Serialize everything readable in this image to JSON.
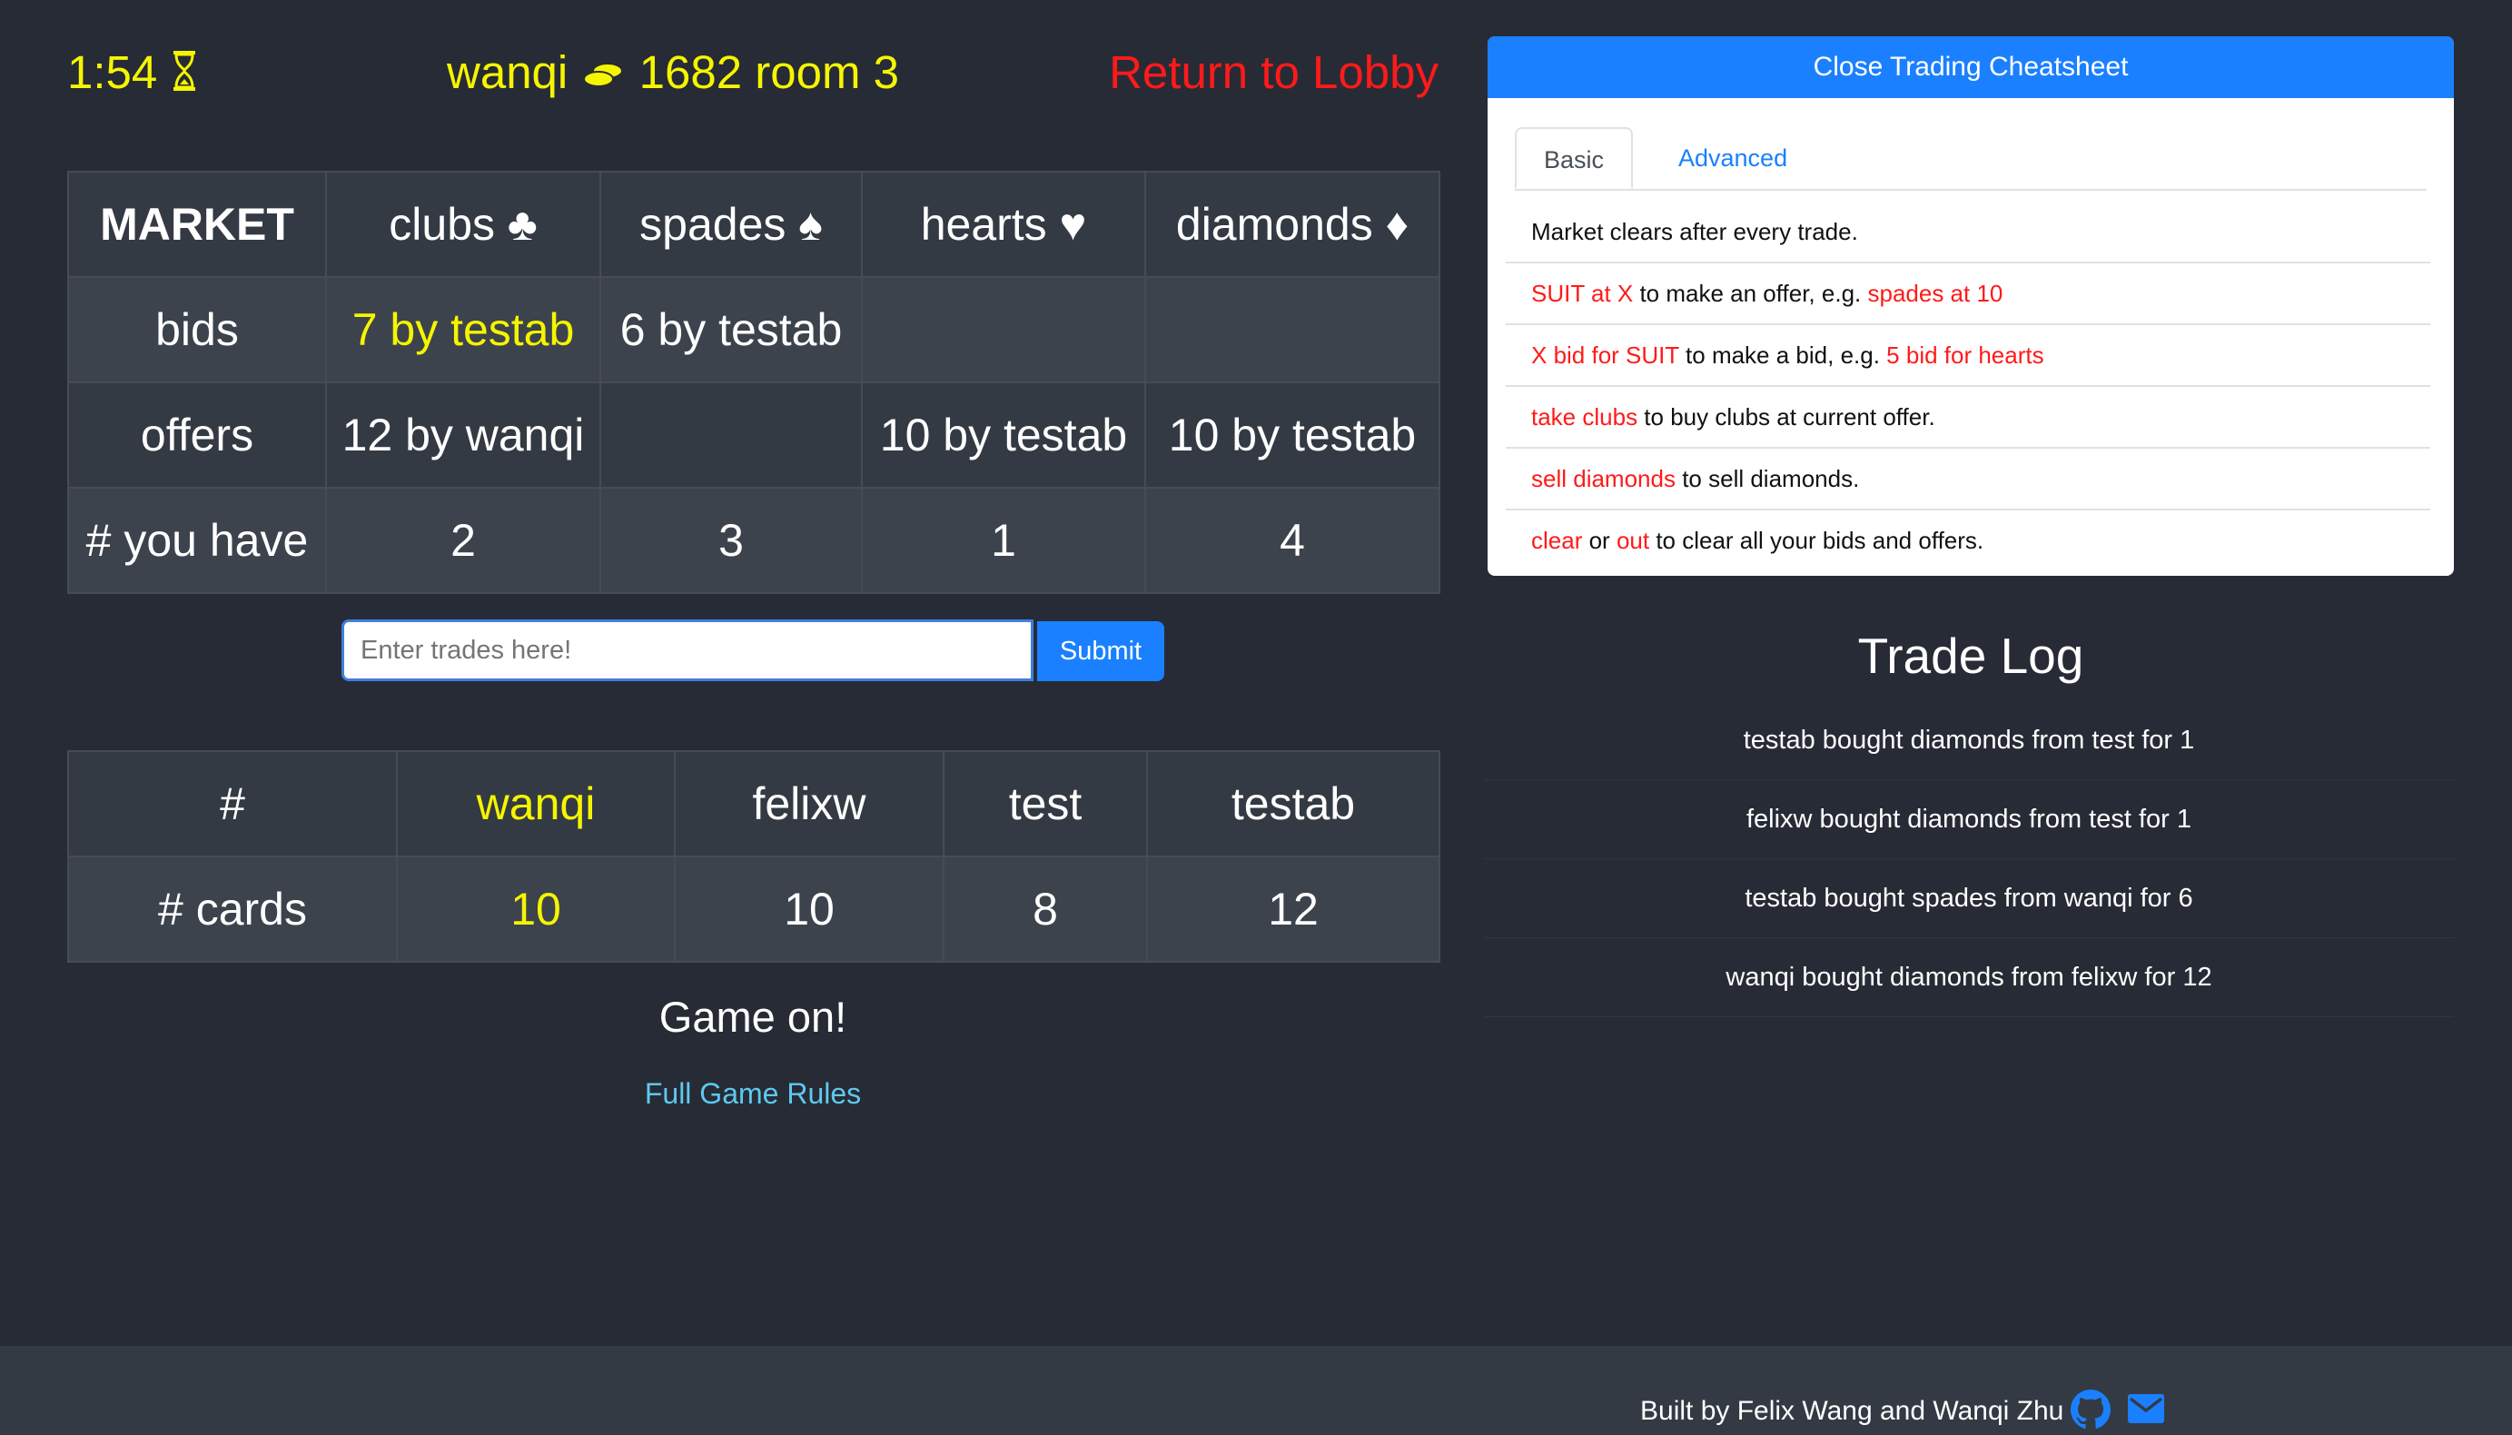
{
  "header": {
    "timer": "1:54",
    "player_info": "wanqi",
    "coins": "1682 room 3",
    "return_link": "Return to Lobby"
  },
  "market": {
    "headers": {
      "market": "MARKET",
      "clubs": "clubs ♣",
      "spades": "spades ♠",
      "hearts": "hearts ♥",
      "diamonds": "diamonds ♦"
    },
    "rows": {
      "bids": {
        "label": "bids",
        "clubs": "7 by testab",
        "spades": "6 by testab",
        "hearts": "",
        "diamonds": ""
      },
      "offers": {
        "label": "offers",
        "clubs": "12 by wanqi",
        "spades": "",
        "hearts": "10 by testab",
        "diamonds": "10 by testab"
      },
      "have": {
        "label": "# you have",
        "clubs": "2",
        "spades": "3",
        "hearts": "1",
        "diamonds": "4"
      }
    }
  },
  "trade_form": {
    "placeholder": "Enter trades here!",
    "submit": "Submit"
  },
  "players": {
    "header_label": "#",
    "names": [
      "wanqi",
      "felixw",
      "test",
      "testab"
    ],
    "cards_label": "# cards",
    "cards": [
      "10",
      "10",
      "8",
      "12"
    ]
  },
  "status": "Game on!",
  "rules_link": "Full Game Rules",
  "cheatsheet": {
    "close_button": "Close Trading Cheatsheet",
    "tabs": [
      "Basic",
      "Advanced"
    ],
    "rules": {
      "r1": {
        "text": "Market clears after every trade."
      },
      "r2": {
        "a": "SUIT at X",
        "b": " to make an offer, e.g. ",
        "c": "spades at 10"
      },
      "r3": {
        "a": "X bid for SUIT",
        "b": " to make a bid, e.g. ",
        "c": "5 bid for hearts"
      },
      "r4": {
        "a": "take clubs",
        "b": " to buy clubs at current offer."
      },
      "r5": {
        "a": "sell diamonds",
        "b": " to sell diamonds."
      },
      "r6": {
        "a": "clear",
        "b": " or ",
        "c": "out",
        "d": " to clear all your bids and offers."
      }
    }
  },
  "trade_log": {
    "title": "Trade Log",
    "entries": [
      "testab bought diamonds from test for 1",
      "felixw bought diamonds from test for 1",
      "testab bought spades from wanqi for 6",
      "wanqi bought diamonds from felixw for 12"
    ]
  },
  "footer": {
    "credit": "Built by Felix Wang and Wanqi Zhu"
  },
  "colors": {
    "background": "#272b35",
    "highlight": "#f5f500",
    "red": "#ff1a1a",
    "primary": "#1a80ff",
    "link": "#5ec9f0"
  },
  "icons": [
    "hourglass-icon",
    "coins-icon",
    "github-icon",
    "mail-icon"
  ]
}
